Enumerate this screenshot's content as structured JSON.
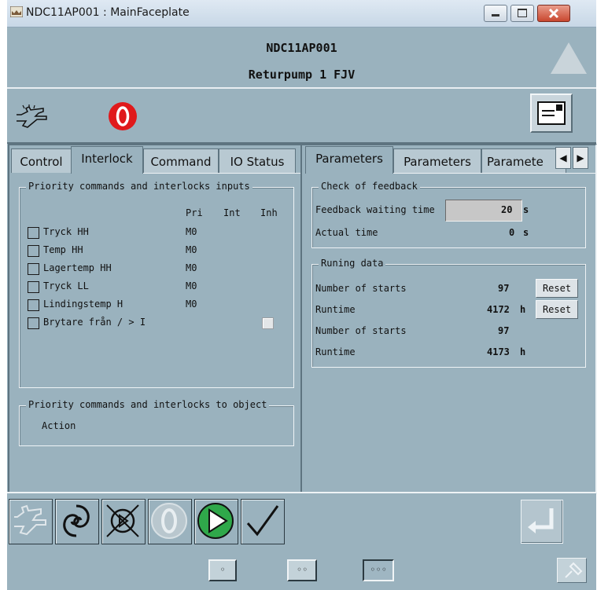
{
  "window": {
    "title": "NDC11AP001 : MainFaceplate"
  },
  "header": {
    "tag": "NDC11AP001",
    "description": "Returpump 1 FJV"
  },
  "left_panel": {
    "tabs": [
      "Control",
      "Interlock",
      "Command",
      "IO Status"
    ],
    "active_tab": "Interlock",
    "inputs_group": {
      "title": "Priority commands and interlocks inputs",
      "columns": [
        "Pri",
        "Int",
        "Inh"
      ],
      "rows": [
        {
          "label": "Tryck HH",
          "pri": "M0"
        },
        {
          "label": "Temp HH",
          "pri": "M0"
        },
        {
          "label": "Lagertemp HH",
          "pri": "M0"
        },
        {
          "label": "Tryck LL",
          "pri": "M0"
        },
        {
          "label": "Lindingstemp H",
          "pri": "M0"
        },
        {
          "label": "Brytare från / > I",
          "pri": ""
        }
      ]
    },
    "object_group": {
      "title": "Priority commands and interlocks to object",
      "action_label": "Action"
    }
  },
  "right_panel": {
    "tabs": [
      "Parameters",
      "Parameters",
      "Paramete"
    ],
    "active_tab": "Parameters",
    "feedback_group": {
      "title": "Check of feedback",
      "waiting_label": "Feedback waiting time",
      "waiting_value": "20",
      "waiting_unit": "s",
      "actual_label": "Actual time",
      "actual_value": "0",
      "actual_unit": "s"
    },
    "running_group": {
      "title": "Runing data",
      "rows": [
        {
          "label": "Number of starts",
          "value": "97",
          "unit": "",
          "button": "Reset"
        },
        {
          "label": "Runtime",
          "value": "4172",
          "unit": "h",
          "button": "Reset"
        },
        {
          "label": "Number of starts",
          "value": "97",
          "unit": "",
          "button": ""
        },
        {
          "label": "Runtime",
          "value": "4173",
          "unit": "h",
          "button": ""
        }
      ]
    }
  },
  "statusbar": {
    "page1": "◦",
    "page2": "◦◦",
    "page3": "◦◦◦"
  },
  "colors": {
    "panel_bg": "#9ab2be",
    "stop_red": "#e0191b",
    "start_green": "#2fa84a"
  },
  "icons": [
    "hand-icon",
    "stop-icon",
    "message-icon",
    "manual-icon",
    "auto-icon",
    "out-of-service-icon",
    "stop-disabled-icon",
    "start-icon",
    "acknowledge-icon",
    "return-icon",
    "pin-icon"
  ]
}
